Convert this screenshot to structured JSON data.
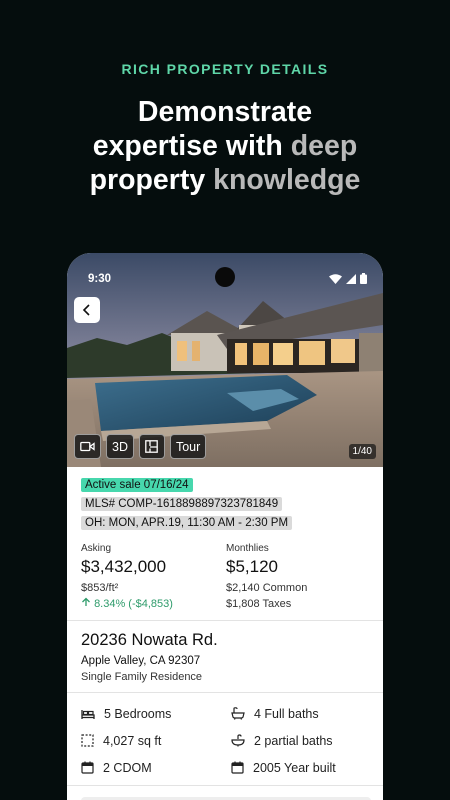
{
  "promo": {
    "eyebrow": "RICH PROPERTY DETAILS",
    "headline_line1": "Demonstrate",
    "headline_line2_bright": "expertise with",
    "headline_line2_dim": " deep",
    "headline_line3_bright": "property",
    "headline_line3_dim": " knowledge"
  },
  "status_bar": {
    "time": "9:30"
  },
  "media": {
    "video_icon": "video-camera-icon",
    "btn_3d": "3D",
    "floorplan_icon": "floorplan-icon",
    "btn_tour": "Tour",
    "photo_count": "1/40"
  },
  "listing": {
    "status_badge": "Active sale 07/16/24",
    "mls": "MLS# COMP-1618898897323781849",
    "open_house": "OH: MON, APR.19, 11:30 AM - 2:30 PM",
    "asking_label": "Asking",
    "asking_price": "$3,432,000",
    "price_per_sqft": "$853/ft²",
    "price_change": "8.34%  (-$4,853)",
    "monthlies_label": "Monthlies",
    "monthlies_total": "$5,120",
    "common": "$2,140 Common",
    "taxes": "$1,808 Taxes"
  },
  "address": {
    "street": "20236 Nowata Rd.",
    "city_state_zip": "Apple Valley, CA 92307",
    "property_type": "Single Family Residence"
  },
  "facts": [
    {
      "icon": "bed-icon",
      "text": "5 Bedrooms"
    },
    {
      "icon": "bathtub-icon",
      "text": "4 Full baths"
    },
    {
      "icon": "area-icon",
      "text": "4,027 sq ft"
    },
    {
      "icon": "sink-icon",
      "text": "2 partial baths"
    },
    {
      "icon": "calendar-icon",
      "text": "2 CDOM"
    },
    {
      "icon": "calendar-icon",
      "text": "2005 Year built"
    }
  ],
  "colors": {
    "background": "#050d0d",
    "accent_green": "#5fd6a8",
    "active_badge": "#47d7ad",
    "price_up": "#2e9b6b"
  }
}
